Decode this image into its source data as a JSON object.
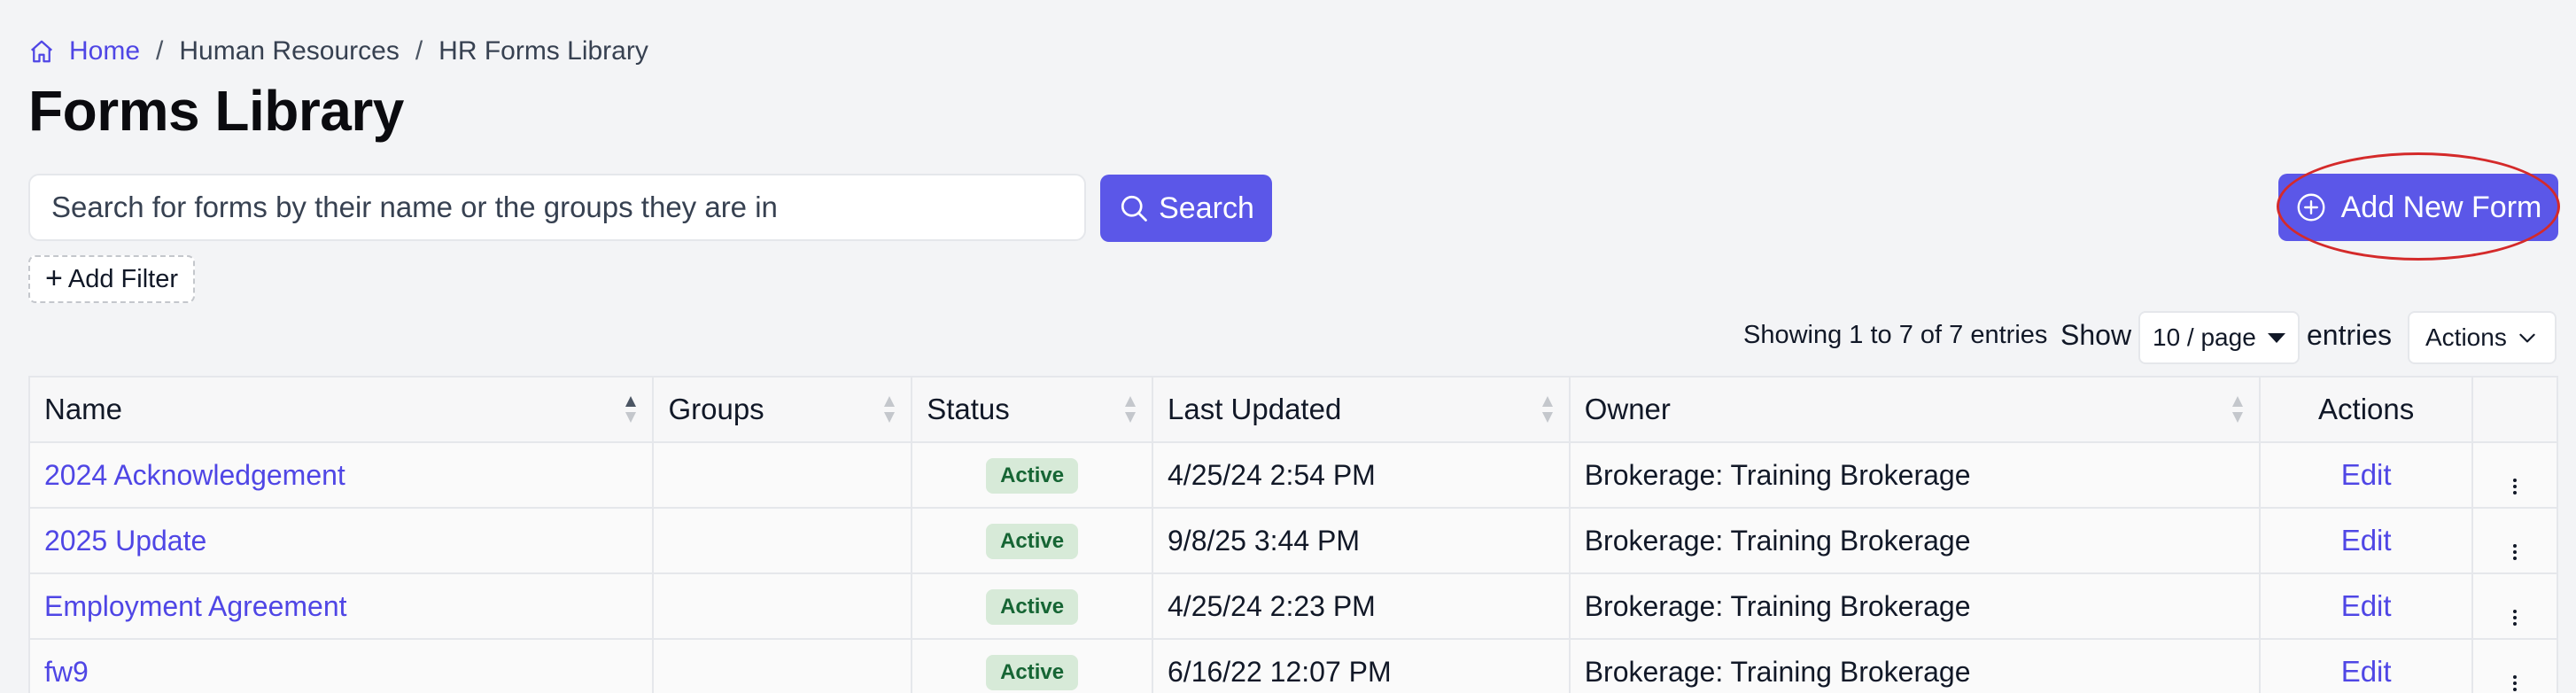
{
  "breadcrumb": {
    "home": "Home",
    "separator": "/",
    "section": "Human Resources",
    "current": "HR Forms Library"
  },
  "page_title": "Forms Library",
  "search": {
    "placeholder": "Search for forms by their name or the groups they are in",
    "button_label": "Search"
  },
  "add_new_form_label": "Add New Form",
  "add_filter_label": "Add Filter",
  "pagination": {
    "showing": "Showing 1 to 7 of 7 entries",
    "show_label": "Show",
    "page_size": "10 / page",
    "entries_label": "entries",
    "actions_label": "Actions"
  },
  "table": {
    "columns": {
      "name": "Name",
      "groups": "Groups",
      "status": "Status",
      "last_updated": "Last Updated",
      "owner": "Owner",
      "actions": "Actions"
    },
    "rows": [
      {
        "name": "2024 Acknowledgement",
        "groups": "",
        "status": "Active",
        "last_updated": "4/25/24 2:54 PM",
        "owner": "Brokerage: Training Brokerage",
        "action": "Edit"
      },
      {
        "name": "2025 Update",
        "groups": "",
        "status": "Active",
        "last_updated": "9/8/25 3:44 PM",
        "owner": "Brokerage: Training Brokerage",
        "action": "Edit"
      },
      {
        "name": "Employment Agreement",
        "groups": "",
        "status": "Active",
        "last_updated": "4/25/24 2:23 PM",
        "owner": "Brokerage: Training Brokerage",
        "action": "Edit"
      },
      {
        "name": "fw9",
        "groups": "",
        "status": "Active",
        "last_updated": "6/16/22 12:07 PM",
        "owner": "Brokerage: Training Brokerage",
        "action": "Edit"
      }
    ]
  },
  "colors": {
    "primary": "#5b57e8",
    "link": "#4f46e5",
    "badge_bg": "#d7ead8",
    "badge_text": "#166534",
    "highlight": "#d42a2a"
  },
  "icons": {
    "home": "home-icon",
    "search": "search-icon",
    "add": "plus-circle-icon",
    "sort": "sort-icon",
    "chevron": "chevron-down-icon",
    "kebab": "kebab-menu-icon"
  }
}
